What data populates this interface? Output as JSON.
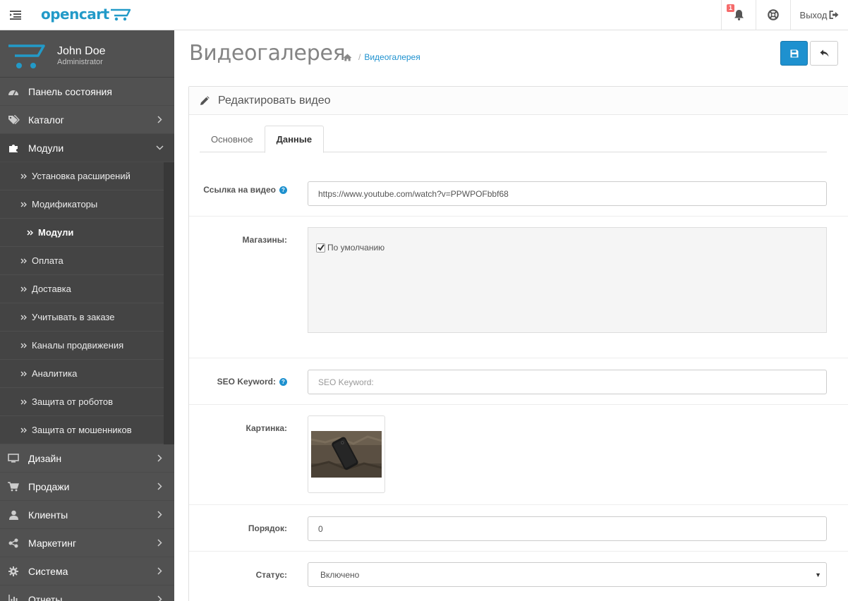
{
  "header": {
    "logo_text": "opencart",
    "notifications_count": "1",
    "logout_label": "Выход"
  },
  "profile": {
    "name": "John Doe",
    "role": "Administrator"
  },
  "sidebar": {
    "items": [
      {
        "label": "Панель состояния",
        "icon": "dashboard-icon"
      },
      {
        "label": "Каталог",
        "icon": "tags-icon"
      },
      {
        "label": "Модули",
        "icon": "puzzle-icon"
      },
      {
        "label": "Дизайн",
        "icon": "desktop-icon"
      },
      {
        "label": "Продажи",
        "icon": "cart-icon"
      },
      {
        "label": "Клиенты",
        "icon": "user-icon"
      },
      {
        "label": "Маркетинг",
        "icon": "share-icon"
      },
      {
        "label": "Система",
        "icon": "cog-icon"
      },
      {
        "label": "Отчеты",
        "icon": "bar-chart-icon"
      }
    ],
    "submenu": [
      "Установка расширений",
      "Модификаторы",
      "Модули",
      "Оплата",
      "Доставка",
      "Учитывать в заказе",
      "Каналы продвижения",
      "Аналитика",
      "Защита от роботов",
      "Защита от мошенников"
    ]
  },
  "page": {
    "title": "Видеогалерея",
    "breadcrumb": "Видеогалерея",
    "panel_title": "Редактировать видео"
  },
  "tabs": [
    "Основное",
    "Данные"
  ],
  "form": {
    "video_link_label": "Ссылка на видео",
    "video_link_value": "https://www.youtube.com/watch?v=PPWPOFbbf68",
    "stores_label": "Магазины:",
    "store_default": "По умолчанию",
    "seo_label": "SEO Keyword:",
    "seo_placeholder": "SEO Keyword:",
    "image_label": "Картинка:",
    "order_label": "Порядок:",
    "order_value": "0",
    "status_label": "Статус:",
    "status_value": "Включено"
  },
  "colors": {
    "accent": "#1e91cf",
    "sidebar_bg": "#515151",
    "sidebar_active": "#444444"
  }
}
